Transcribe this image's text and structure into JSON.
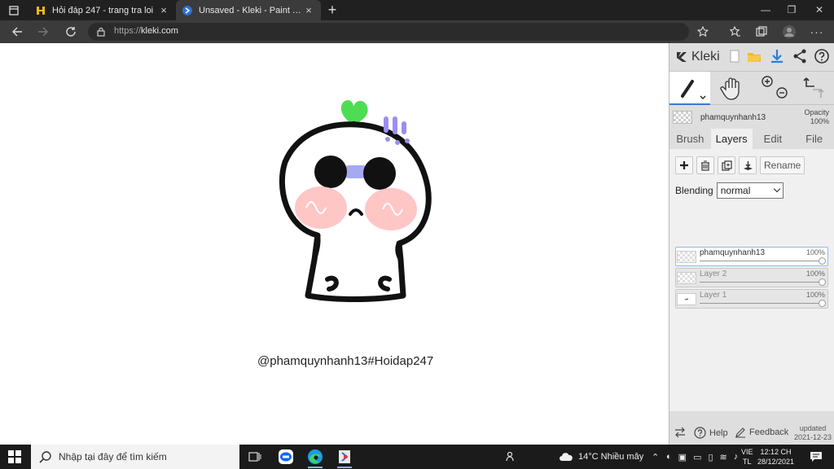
{
  "browser": {
    "tabs": [
      {
        "title": "Hỏi đáp 247 - trang tra loi",
        "active": false
      },
      {
        "title": "Unsaved - Kleki - Paint Tool",
        "active": true
      }
    ],
    "url_protocol": "https://",
    "url_host": "kleki.com",
    "new_tab": "+",
    "close_glyph": "×",
    "window_controls": [
      "—",
      "❐",
      "✕"
    ]
  },
  "canvas": {
    "caption": "@phamquynhanh13#Hoidap247"
  },
  "kleki": {
    "logo_text": "Kleki",
    "current_layer_name": "phamquynhanh13",
    "opacity_label": "Opacity",
    "opacity_value": "100%",
    "tabs": [
      "Brush",
      "Layers",
      "Edit",
      "File"
    ],
    "active_tab": "Layers",
    "rename_label": "Rename",
    "blending_label": "Blending",
    "blending_value": "normal",
    "layers": [
      {
        "name": "phamquynhanh13",
        "opacity": "100%",
        "selected": true
      },
      {
        "name": "Layer 2",
        "opacity": "100%",
        "selected": false
      },
      {
        "name": "Layer 1",
        "opacity": "100%",
        "selected": false
      }
    ],
    "footer": {
      "help": "Help",
      "feedback": "Feedback",
      "updated_label": "updated",
      "updated_date": "2021-12-23"
    }
  },
  "taskbar": {
    "search_placeholder": "Nhập tại đây để tìm kiếm",
    "weather": "14°C  Nhiều mây",
    "lang_top": "VIE",
    "lang_bottom": "TL",
    "time": "12:12 CH",
    "date": "28/12/2021"
  },
  "colors": {
    "sprout": "#4ddd53",
    "accent_purple": "#9a8ef0",
    "blush": "#ffb3b3",
    "kleki_accent": "#3a7bd5"
  }
}
